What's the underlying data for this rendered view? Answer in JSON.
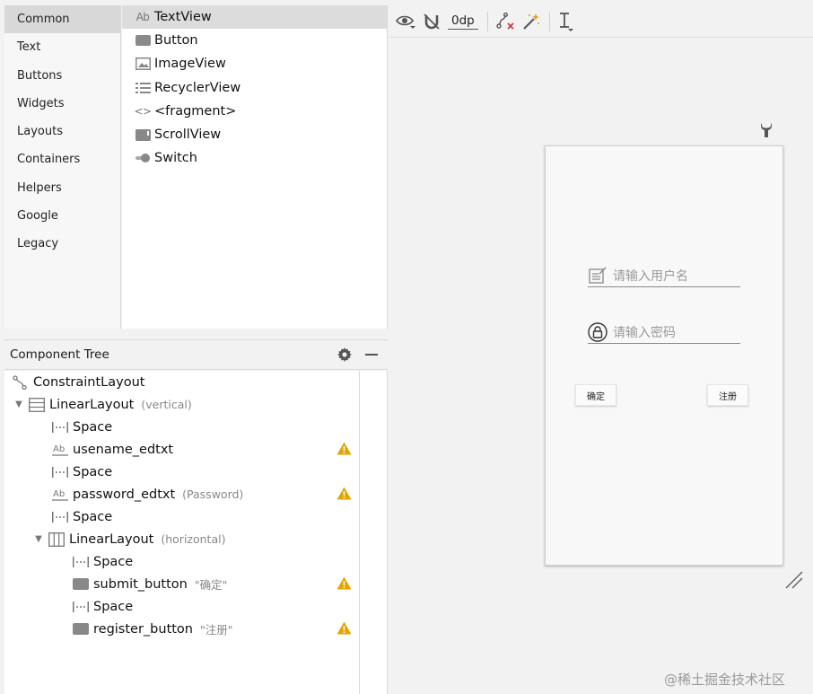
{
  "palette": {
    "categories": [
      "Common",
      "Text",
      "Buttons",
      "Widgets",
      "Layouts",
      "Containers",
      "Helpers",
      "Google",
      "Legacy"
    ],
    "selected_category": "Common",
    "items": [
      {
        "label": "TextView",
        "icon": "textview-icon",
        "icon_text": "Ab"
      },
      {
        "label": "Button",
        "icon": "button-icon"
      },
      {
        "label": "ImageView",
        "icon": "imageview-icon"
      },
      {
        "label": "RecyclerView",
        "icon": "recyclerview-icon"
      },
      {
        "label": "<fragment>",
        "icon": "fragment-icon",
        "icon_text": "<>"
      },
      {
        "label": "ScrollView",
        "icon": "scrollview-icon"
      },
      {
        "label": "Switch",
        "icon": "switch-icon"
      }
    ]
  },
  "component_tree": {
    "title": "Component Tree",
    "nodes": [
      {
        "label": "ConstraintLayout",
        "extra": "",
        "icon": "constraintlayout-icon",
        "warn": false
      },
      {
        "label": "LinearLayout",
        "extra": "(vertical)",
        "icon": "linearlayout-vertical-icon",
        "warn": false
      },
      {
        "label": "Space",
        "extra": "",
        "icon": "space-icon",
        "warn": false
      },
      {
        "label": "usename_edtxt",
        "extra": "",
        "icon": "edittext-icon",
        "icon_text": "Ab",
        "warn": true
      },
      {
        "label": "Space",
        "extra": "",
        "icon": "space-icon",
        "warn": false
      },
      {
        "label": "password_edtxt",
        "extra": "(Password)",
        "icon": "edittext-icon",
        "icon_text": "Ab",
        "warn": true
      },
      {
        "label": "Space",
        "extra": "",
        "icon": "space-icon",
        "warn": false
      },
      {
        "label": "LinearLayout",
        "extra": "(horizontal)",
        "icon": "linearlayout-horizontal-icon",
        "warn": false
      },
      {
        "label": "Space",
        "extra": "",
        "icon": "space-icon",
        "warn": false
      },
      {
        "label": "submit_button",
        "extra": "\"确定\"",
        "icon": "button-icon",
        "warn": true
      },
      {
        "label": "Space",
        "extra": "",
        "icon": "space-icon",
        "warn": false
      },
      {
        "label": "register_button",
        "extra": "\"注册\"",
        "icon": "button-icon",
        "warn": true
      }
    ]
  },
  "toolbar": {
    "default_margin": "0dp"
  },
  "preview": {
    "username_hint": "请输入用户名",
    "password_hint": "请输入密码",
    "submit_label": "确定",
    "register_label": "注册"
  },
  "watermark": "@稀土掘金技术社区",
  "colors": {
    "warning": "#e2a400",
    "icon_gray": "#777777",
    "selected_bg": "#d8d8d8"
  }
}
